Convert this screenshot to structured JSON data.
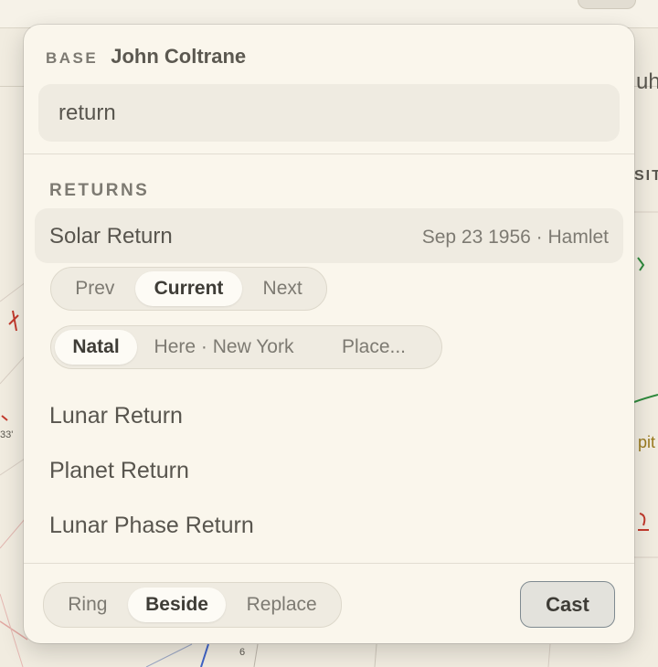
{
  "background": {
    "right_text_fragments": [
      "uh",
      "SIT",
      "pit"
    ],
    "left_text_fragments": [
      "h",
      "33'"
    ],
    "chart_number": "6"
  },
  "popover": {
    "base_label": "BASE",
    "base_name": "John Coltrane",
    "search_value": "return",
    "section_title": "RETURNS",
    "selected_item": {
      "title": "Solar Return",
      "meta": "Sep 23 1956 · Hamlet"
    },
    "time_segment": {
      "options": [
        "Prev",
        "Current",
        "Next"
      ],
      "selected": "Current"
    },
    "location_segment": {
      "options": [
        "Natal",
        "Here · New York",
        "Place..."
      ],
      "selected": "Natal"
    },
    "items": [
      "Lunar Return",
      "Planet Return",
      "Lunar Phase Return"
    ],
    "footer": {
      "display_segment": {
        "options": [
          "Ring",
          "Beside",
          "Replace"
        ],
        "selected": "Beside"
      },
      "cast_label": "Cast"
    }
  },
  "colors": {
    "popover_bg": "#faf6ec",
    "control_bg": "#efebe1",
    "text_primary": "#58554e",
    "text_muted": "#7d7a72",
    "cast_border": "#7f8a90"
  }
}
